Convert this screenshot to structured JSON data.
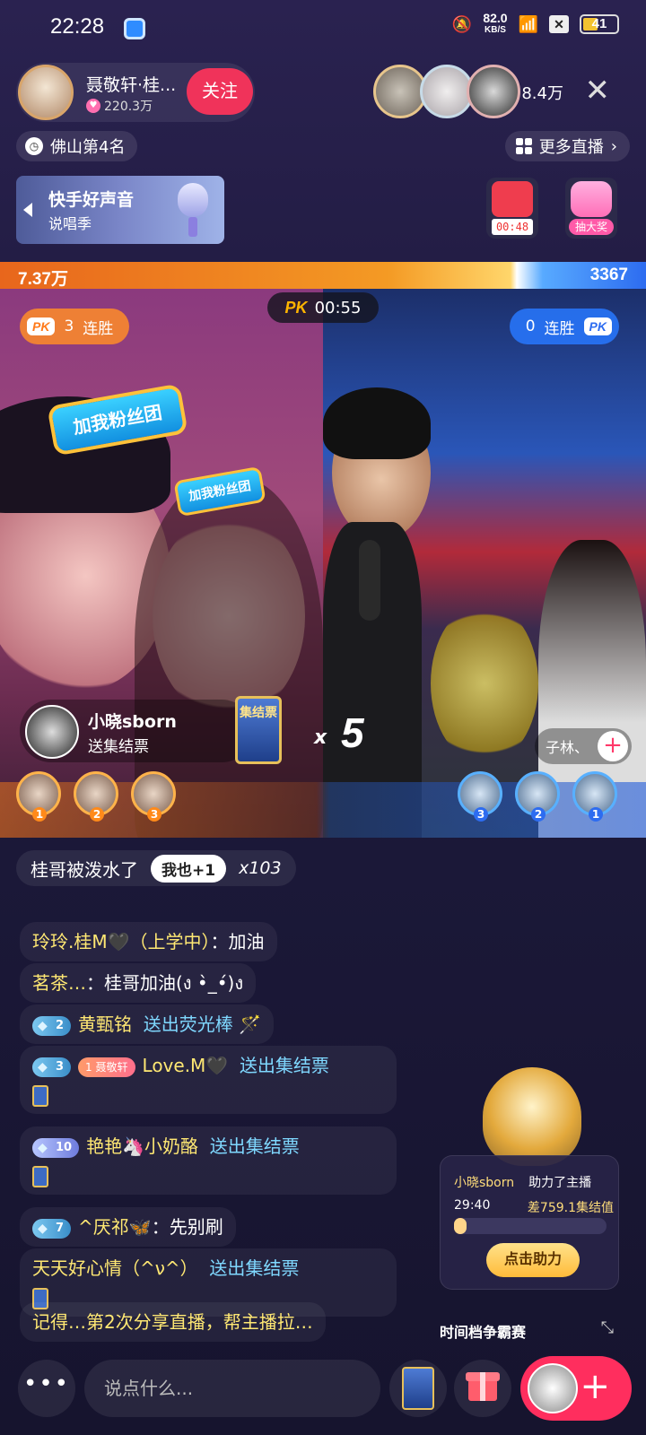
{
  "status": {
    "time": "22:28",
    "speed_value": "82.0",
    "speed_unit": "KB/S",
    "battery": "41"
  },
  "host": {
    "name": "聂敬轩·桂...",
    "likes": "220.3万",
    "follow_label": "关注",
    "rank": "佛山第4名"
  },
  "viewers": {
    "count": "8.4万"
  },
  "more_live": "更多直播",
  "banner": {
    "title": "快手好声音",
    "subtitle": "说唱季"
  },
  "tiles": {
    "timer": "00:48",
    "lottery": "抽大奖"
  },
  "pk": {
    "left_score": "7.37万",
    "right_score": "3367",
    "logo": "PK",
    "timer": "00:55",
    "left_streak_num": "3",
    "left_streak_label": "连胜",
    "right_streak_num": "0",
    "right_streak_label": "连胜",
    "left_share": 0.8
  },
  "overlay": {
    "fanclub": "加我粉丝团",
    "fanclub_small": "加我粉丝团"
  },
  "gift_notice": {
    "user": "小晓sborn",
    "action": "送集结票",
    "ticket_label": "集结票",
    "mult": "x",
    "count": "5"
  },
  "right_contrib": {
    "label": "子林、"
  },
  "rank_left": [
    "1",
    "2",
    "3"
  ],
  "rank_right": [
    "3",
    "2",
    "1"
  ],
  "topic": {
    "text": "桂哥被泼水了",
    "me_too": "我也+1",
    "times": "x103"
  },
  "comments": [
    {
      "name": "玲玲.桂M🖤（上学中）",
      "text": "：加油"
    },
    {
      "name": "茗茶…",
      "text": "：桂哥加油(ง •̀_•́)ง"
    },
    {
      "level": "2",
      "name": "黄甄铭",
      "action": "送出荧光棒"
    },
    {
      "level": "3",
      "fan_level": "1",
      "fan_name": "聂敬轩",
      "name": "Love.M🖤",
      "action": "送出集结票"
    },
    {
      "level": "10",
      "name": "艳艳🦄小奶酪",
      "action": "送出集结票"
    },
    {
      "level": "7",
      "name": "^厌祁🦋",
      "text": "：先别刷"
    },
    {
      "name": "天天好心情（^ν^）",
      "action": "送出集结票"
    },
    {
      "text": "记得…第2次分享直播，帮主播拉…"
    }
  ],
  "support": {
    "user": "小晓sborn",
    "action": "助力了主播",
    "countdown": "29:40",
    "gap": "差759.1集结值",
    "progress": 0.08,
    "button": "点击助力",
    "footer": "时间档争霸赛"
  },
  "bottom": {
    "more": "•••",
    "placeholder": "说点什么..."
  }
}
